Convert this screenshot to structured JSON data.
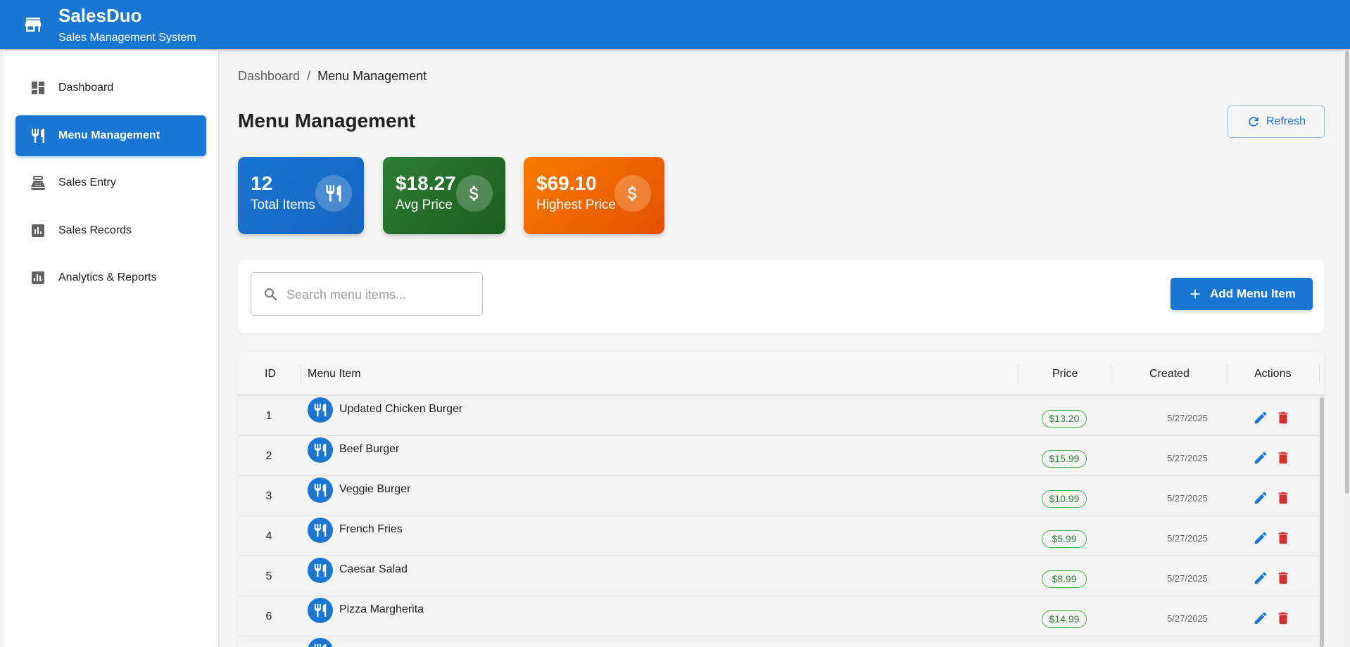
{
  "app": {
    "title": "SalesDuo",
    "subtitle": "Sales Management System"
  },
  "sidebar": {
    "items": [
      {
        "label": "Dashboard",
        "icon": "dashboard-icon",
        "active": false
      },
      {
        "label": "Menu Management",
        "icon": "restaurant-icon",
        "active": true
      },
      {
        "label": "Sales Entry",
        "icon": "point-of-sale-icon",
        "active": false
      },
      {
        "label": "Sales Records",
        "icon": "assessment-icon",
        "active": false
      },
      {
        "label": "Analytics & Reports",
        "icon": "bar-chart-icon",
        "active": false
      }
    ]
  },
  "breadcrumb": {
    "root": "Dashboard",
    "separator": "/",
    "current": "Menu Management"
  },
  "page": {
    "title": "Menu Management",
    "refresh_label": "Refresh"
  },
  "stats": {
    "total_items": {
      "value": "12",
      "label": "Total Items"
    },
    "avg_price": {
      "value": "$18.27",
      "label": "Avg Price"
    },
    "highest_price": {
      "value": "$69.10",
      "label": "Highest Price"
    }
  },
  "search": {
    "placeholder": "Search menu items...",
    "value": ""
  },
  "add_button_label": "Add Menu Item",
  "table": {
    "headers": {
      "id": "ID",
      "item": "Menu Item",
      "price": "Price",
      "created": "Created",
      "actions": "Actions"
    },
    "rows": [
      {
        "id": "1",
        "name": "Updated Chicken Burger",
        "price": "$13.20",
        "created": "5/27/2025"
      },
      {
        "id": "2",
        "name": "Beef Burger",
        "price": "$15.99",
        "created": "5/27/2025"
      },
      {
        "id": "3",
        "name": "Veggie Burger",
        "price": "$10.99",
        "created": "5/27/2025"
      },
      {
        "id": "4",
        "name": "French Fries",
        "price": "$5.99",
        "created": "5/27/2025"
      },
      {
        "id": "5",
        "name": "Caesar Salad",
        "price": "$8.99",
        "created": "5/27/2025"
      },
      {
        "id": "6",
        "name": "Pizza Margherita",
        "price": "$14.99",
        "created": "5/27/2025"
      }
    ]
  },
  "colors": {
    "primary": "#1976d2",
    "success": "#2e7d32",
    "warning": "#f57c00",
    "danger": "#d32f2f"
  }
}
